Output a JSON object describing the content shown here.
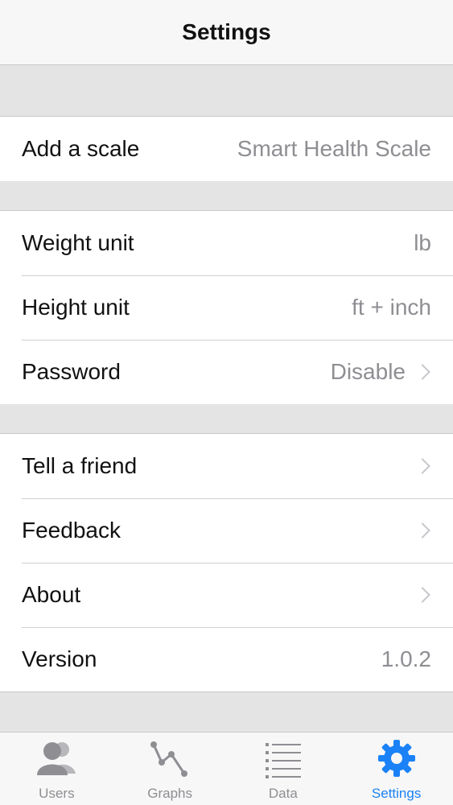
{
  "nav": {
    "title": "Settings"
  },
  "groups": {
    "scale": {
      "add_scale": {
        "label": "Add a scale",
        "value": "Smart Health Scale"
      }
    },
    "units": {
      "weight_unit": {
        "label": "Weight unit",
        "value": "lb"
      },
      "height_unit": {
        "label": "Height unit",
        "value": "ft + inch"
      },
      "password": {
        "label": "Password",
        "value": "Disable"
      }
    },
    "info": {
      "tell_friend": {
        "label": "Tell a friend"
      },
      "feedback": {
        "label": "Feedback"
      },
      "about": {
        "label": "About"
      },
      "version": {
        "label": "Version",
        "value": "1.0.2"
      }
    }
  },
  "tabbar": {
    "items": [
      {
        "label": "Users",
        "icon": "users-icon",
        "active": false
      },
      {
        "label": "Graphs",
        "icon": "graph-icon",
        "active": false
      },
      {
        "label": "Data",
        "icon": "list-icon",
        "active": false
      },
      {
        "label": "Settings",
        "icon": "gear-icon",
        "active": true
      }
    ]
  },
  "colors": {
    "accent": "#1a82f6",
    "inactive": "#8e8e93",
    "background": "#efeff4"
  }
}
